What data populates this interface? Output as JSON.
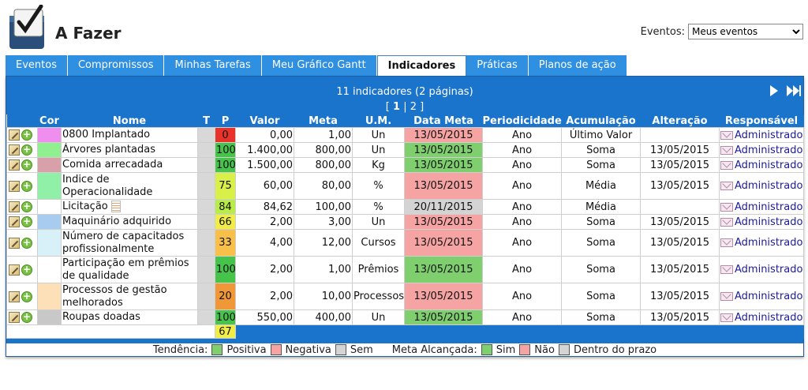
{
  "app": {
    "title": "A Fazer",
    "logo_icon": "checkbox-logo-icon"
  },
  "events_filter": {
    "label": "Eventos:",
    "selected": "Meus eventos",
    "options": [
      "Meus eventos"
    ]
  },
  "tabs": [
    {
      "label": "Eventos",
      "active": false
    },
    {
      "label": "Compromissos",
      "active": false
    },
    {
      "label": "Minhas Tarefas",
      "active": false
    },
    {
      "label": "Meu Gráfico Gantt",
      "active": false
    },
    {
      "label": "Indicadores",
      "active": true
    },
    {
      "label": "Práticas",
      "active": false
    },
    {
      "label": "Planos de ação",
      "active": false
    }
  ],
  "panel": {
    "count_text": "11 indicadores (2 páginas)",
    "pages": {
      "open": "[",
      "current": "1",
      "sep": "|",
      "other": "2",
      "close": "]"
    }
  },
  "columns": [
    "Cor",
    "Nome",
    "T",
    "P",
    "Valor",
    "Meta",
    "U.M.",
    "Data Meta",
    "Periodicidade",
    "Acumulação",
    "Alteração",
    "Responsável"
  ],
  "rows": [
    {
      "color": "#f08ef0",
      "name": "0800 Implantado",
      "p": "0",
      "p_color": "#e8332a",
      "valor": "0,00",
      "meta": "1,00",
      "um": "Un",
      "data_meta": "13/05/2015",
      "data_color": "#f5a3a3",
      "periodicidade": "Ano",
      "acumulacao": "Último Valor",
      "alteracao": "",
      "responsavel": "Administrador",
      "doc": false
    },
    {
      "color": "#90f090",
      "name": "Árvores plantadas",
      "p": "100",
      "p_color": "#46c34a",
      "valor": "1.400,00",
      "meta": "800,00",
      "um": "Un",
      "data_meta": "13/05/2015",
      "data_color": "#7fcf6f",
      "periodicidade": "Ano",
      "acumulacao": "Soma",
      "alteracao": "13/05/2015",
      "responsavel": "Administrador",
      "doc": false
    },
    {
      "color": "#d8a0a8",
      "name": "Comida arrecadada",
      "p": "100",
      "p_color": "#46c34a",
      "valor": "1.500,00",
      "meta": "800,00",
      "um": "Kg",
      "data_meta": "13/05/2015",
      "data_color": "#7fcf6f",
      "periodicidade": "Ano",
      "acumulacao": "Soma",
      "alteracao": "13/05/2015",
      "responsavel": "Administrador",
      "doc": false
    },
    {
      "color": "#90f0a8",
      "name": "Indice de Operacionalidade",
      "p": "75",
      "p_color": "#d8f048",
      "valor": "60,00",
      "meta": "80,00",
      "um": "%",
      "data_meta": "13/05/2015",
      "data_color": "#f5a3a3",
      "periodicidade": "Ano",
      "acumulacao": "Média",
      "alteracao": "13/05/2015",
      "responsavel": "Administrador",
      "doc": false
    },
    {
      "color": "#ffffff",
      "name": "Licitação",
      "p": "84",
      "p_color": "#b8ec48",
      "valor": "84,62",
      "meta": "100,00",
      "um": "%",
      "data_meta": "20/11/2015",
      "data_color": "#d4d4d4",
      "periodicidade": "Ano",
      "acumulacao": "Média",
      "alteracao": "",
      "responsavel": "Administrador",
      "doc": true
    },
    {
      "color": "#a8ccf0",
      "name": "Maquinário adquirido",
      "p": "66",
      "p_color": "#f0ec48",
      "valor": "2,00",
      "meta": "3,00",
      "um": "Un",
      "data_meta": "13/05/2015",
      "data_color": "#f5a3a3",
      "periodicidade": "Ano",
      "acumulacao": "Soma",
      "alteracao": "13/05/2015",
      "responsavel": "Administrador",
      "doc": false
    },
    {
      "color": "#d8f0f8",
      "name": "Número de capacitados profissionalmente",
      "p": "33",
      "p_color": "#f8c048",
      "valor": "4,00",
      "meta": "12,00",
      "um": "Cursos",
      "data_meta": "13/05/2015",
      "data_color": "#f5a3a3",
      "periodicidade": "Ano",
      "acumulacao": "Soma",
      "alteracao": "13/05/2015",
      "responsavel": "Administrador",
      "doc": false
    },
    {
      "color": "#ffffff",
      "name": "Participação em prêmios de qualidade",
      "p": "100",
      "p_color": "#46c34a",
      "valor": "2,00",
      "meta": "1,00",
      "um": "Prêmios",
      "data_meta": "13/05/2015",
      "data_color": "#7fcf6f",
      "periodicidade": "Ano",
      "acumulacao": "Soma",
      "alteracao": "13/05/2015",
      "responsavel": "Administrador",
      "doc": false
    },
    {
      "color": "#fde0b8",
      "name": "Processos de gestão melhorados",
      "p": "20",
      "p_color": "#f09838",
      "valor": "2,00",
      "meta": "10,00",
      "um": "Processos",
      "data_meta": "13/05/2015",
      "data_color": "#f5a3a3",
      "periodicidade": "Ano",
      "acumulacao": "Soma",
      "alteracao": "13/05/2015",
      "responsavel": "Administrador",
      "doc": false
    },
    {
      "color": "#c8c8c8",
      "name": "Roupas doadas",
      "p": "100",
      "p_color": "#46c34a",
      "valor": "550,00",
      "meta": "400,00",
      "um": "Un",
      "data_meta": "13/05/2015",
      "data_color": "#7fcf6f",
      "periodicidade": "Ano",
      "acumulacao": "Soma",
      "alteracao": "13/05/2015",
      "responsavel": "Administrador",
      "doc": false
    }
  ],
  "total": {
    "p": "67",
    "p_color": "#f0ec48"
  },
  "legend": {
    "tendencia_label": "Tendência:",
    "positiva": "Positiva",
    "negativa": "Negativa",
    "sem": "Sem",
    "meta_label": "Meta Alcançada:",
    "sim": "Sim",
    "nao": "Não",
    "prazo": "Dentro do prazo",
    "colors": {
      "positiva": "#7fcf6f",
      "negativa": "#f5a3a3",
      "sem": "#d4d4d4",
      "sim": "#7fcf6f",
      "nao": "#f5a3a3",
      "prazo": "#d4d4d4"
    }
  }
}
